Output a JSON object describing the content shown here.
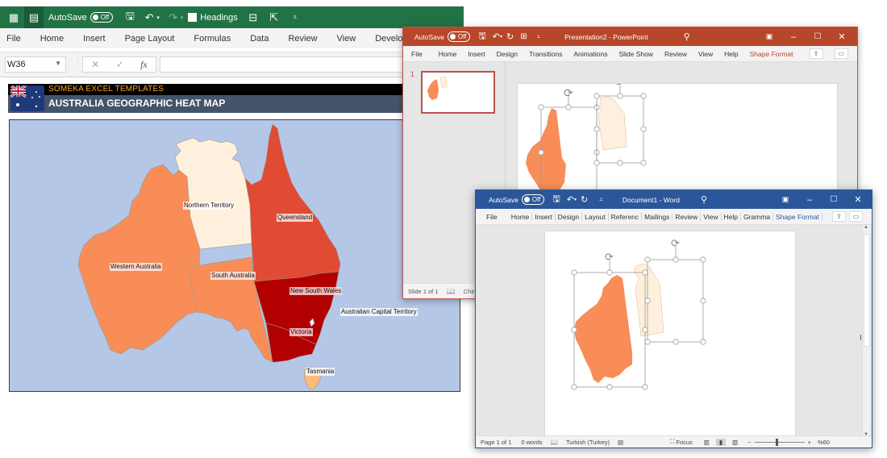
{
  "excel": {
    "quick_access": {
      "autosave_label": "AutoSave",
      "autosave_state": "Off",
      "headings_label": "Headings"
    },
    "ribbon_tabs": [
      "File",
      "Home",
      "Insert",
      "Page Layout",
      "Formulas",
      "Data",
      "Review",
      "View",
      "Developer"
    ],
    "name_box": "W36",
    "formula_value": "",
    "banner": {
      "subtitle": "SOMEKA EXCEL TEMPLATES",
      "title": "AUSTRALIA GEOGRAPHIC HEAT MAP"
    },
    "map": {
      "regions": [
        {
          "name": "Western Australia",
          "color": "#f88d58"
        },
        {
          "name": "Northern Territory",
          "color": "#fef0dc"
        },
        {
          "name": "South Australia",
          "color": "#f88d58"
        },
        {
          "name": "Queensland",
          "color": "#e14b33"
        },
        {
          "name": "New South Wales",
          "color": "#b20000"
        },
        {
          "name": "Australian Capital Territory",
          "color": "#f0f0f0"
        },
        {
          "name": "Victoria",
          "color": "#b20000"
        },
        {
          "name": "Tasmania",
          "color": "#fdbb7a"
        }
      ],
      "background": "#b4c7e7"
    }
  },
  "powerpoint": {
    "autosave_label": "AutoSave",
    "autosave_state": "Off",
    "title": "Presentation2  -  PowerPoint",
    "ribbon_tabs": [
      "File",
      "Home",
      "Insert",
      "Design",
      "Transitions",
      "Animations",
      "Slide Show",
      "Review",
      "View",
      "Help",
      "Shape Format"
    ],
    "active_tab": "Shape Format",
    "slide_number": "1",
    "status_slide": "Slide 1 of 1",
    "status_language": "Chin",
    "accent": "#b7472a"
  },
  "word": {
    "autosave_label": "AutoSave",
    "autosave_state": "Off",
    "title": "Document1  -  Word",
    "ribbon_tabs": [
      "File",
      "Home",
      "Insert",
      "Design",
      "Layout",
      "Referenc",
      "Mailings",
      "Review",
      "View",
      "Help",
      "Gramma",
      "Shape Format"
    ],
    "active_tab": "Shape Format",
    "status": {
      "page": "Page 1 of 1",
      "words": "0 words",
      "language": "Turkish (Turkey)",
      "focus": "Focus",
      "zoom": "%60"
    },
    "accent": "#2b579a"
  }
}
